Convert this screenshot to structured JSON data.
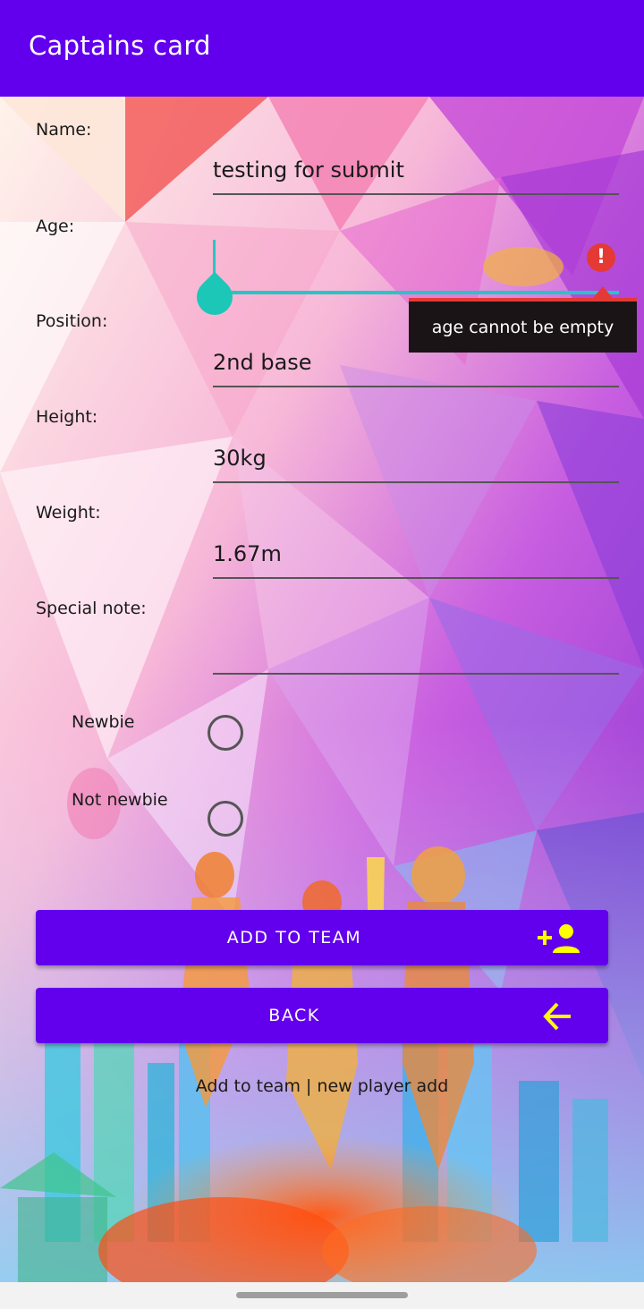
{
  "app_bar": {
    "title": "Captains card",
    "color": "#6200ee"
  },
  "form": {
    "name": {
      "label": "Name:",
      "value": "testing for submit"
    },
    "age": {
      "label": "Age:",
      "seek_value": 0,
      "error_message": "age cannot be empty"
    },
    "position": {
      "label": "Position:",
      "value": "2nd base"
    },
    "height": {
      "label": "Height:",
      "value": "30kg"
    },
    "weight": {
      "label": "Weight:",
      "value": "1.67m"
    },
    "special_note": {
      "label": "Special note:",
      "value": ""
    }
  },
  "radios": [
    {
      "label": "Newbie",
      "checked": false
    },
    {
      "label": "Not newbie",
      "checked": false
    }
  ],
  "buttons": {
    "add_to_team": {
      "label": "ADD TO TEAM",
      "icon": "person-add-icon"
    },
    "back": {
      "label": "BACK",
      "icon": "arrow-left-icon"
    }
  },
  "footer": {
    "text": "Add to team | new player add"
  },
  "colors": {
    "accent": "#26c6c6",
    "icon_yellow": "#ffff00",
    "error": "#e53935"
  }
}
